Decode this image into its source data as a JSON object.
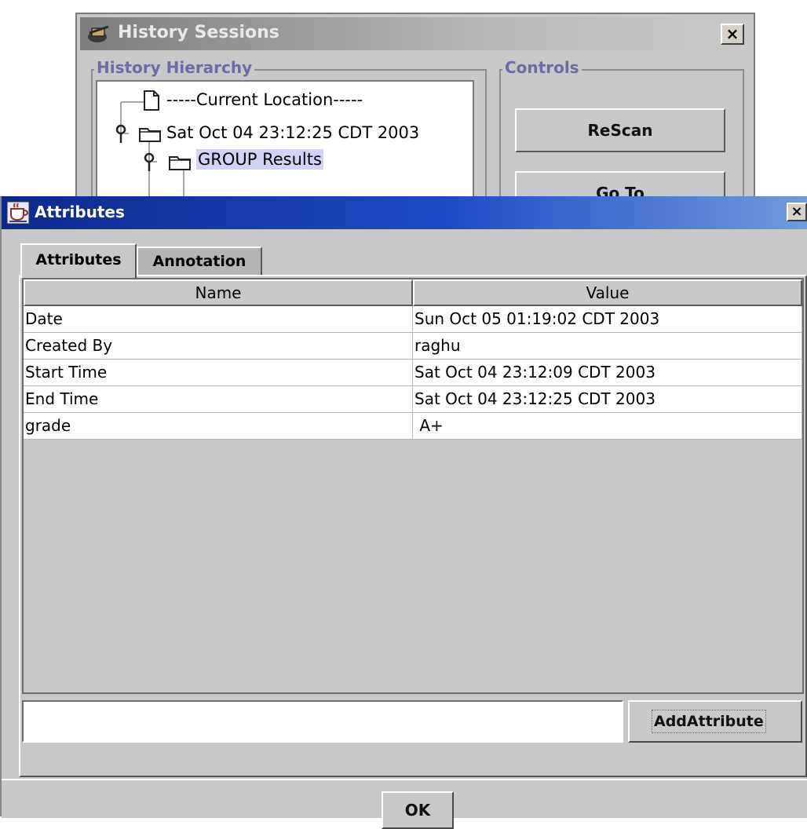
{
  "history_window": {
    "title": "History Sessions",
    "close_label": "×",
    "hierarchy_label": "History Hierarchy",
    "controls_label": "Controls",
    "tree": [
      {
        "label": "-----Current Location-----"
      },
      {
        "label": "Sat Oct 04 23:12:25 CDT 2003"
      },
      {
        "label": "GROUP Results",
        "selected": true
      }
    ],
    "buttons": {
      "rescan": "ReScan",
      "goto": "Go To"
    }
  },
  "attributes_window": {
    "title": "Attributes",
    "close_label": "×",
    "tabs": [
      {
        "label": "Attributes",
        "active": true
      },
      {
        "label": "Annotation",
        "active": false
      }
    ],
    "table": {
      "columns": [
        "Name",
        "Value"
      ],
      "rows": [
        {
          "name": "Date",
          "value": "Sun Oct 05 01:19:02 CDT 2003"
        },
        {
          "name": "Created By",
          "value": "raghu"
        },
        {
          "name": "Start Time",
          "value": "Sat Oct 04 23:12:09 CDT 2003"
        },
        {
          "name": "End Time",
          "value": "Sat Oct 04 23:12:25 CDT 2003"
        },
        {
          "name": "grade",
          "value": " A+"
        }
      ]
    },
    "new_attribute_value": "",
    "add_attribute_label": "AddAttribute",
    "ok_label": "OK"
  },
  "colors": {
    "active_title": "#0b2a8e",
    "inactive_title": "#7d7d7d",
    "panel": "#c8c8c8",
    "selection": "#d2d2f4",
    "group_label": "#6b6ba6"
  }
}
